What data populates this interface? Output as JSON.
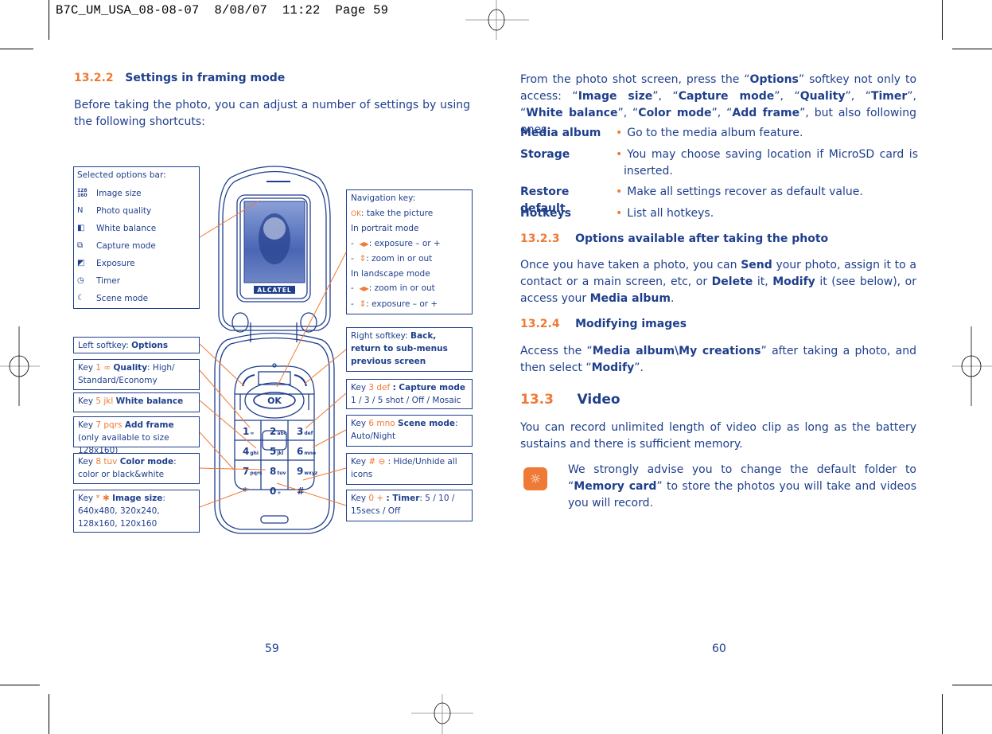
{
  "slug": "B7C_UM_USA_08-08-07  8/08/07  11:22  Page 59",
  "left_page": {
    "section": {
      "number": "13.2.2",
      "title": "Settings in framing mode"
    },
    "intro": "Before taking the photo, you can adjust a number of settings by using the following shortcuts:",
    "options_bar": {
      "title": "Selected options bar:",
      "items": [
        {
          "icon": "image-size-icon",
          "glyph": "128 160",
          "label": "Image size"
        },
        {
          "icon": "photo-quality-icon",
          "glyph": "N",
          "label": "Photo quality"
        },
        {
          "icon": "white-balance-icon",
          "glyph": "◧",
          "label": "White balance"
        },
        {
          "icon": "capture-mode-icon",
          "glyph": "⧉",
          "label": "Capture mode"
        },
        {
          "icon": "exposure-icon",
          "glyph": "◩",
          "label": "Exposure"
        },
        {
          "icon": "timer-icon",
          "glyph": "◷",
          "label": "Timer"
        },
        {
          "icon": "scene-mode-icon",
          "glyph": "☾",
          "label": "Scene mode"
        }
      ]
    },
    "left_callouts": [
      {
        "prefix": "Left softkey: ",
        "key": "",
        "bold": "Options",
        "rest": ""
      },
      {
        "prefix": "Key ",
        "key": "1 ∞",
        "bold": "Quality",
        "rest": ": High/ Standard/Economy"
      },
      {
        "prefix": "Key ",
        "key": "5 jkl",
        "bold": "White balance",
        "rest": ""
      },
      {
        "prefix": "Key ",
        "key": "7 pqrs",
        "bold": "Add frame",
        "rest": " (only available to size 128x160)"
      },
      {
        "prefix": "Key ",
        "key": "8 tuv",
        "bold": "Color mode",
        "rest": ": color or black&white"
      },
      {
        "prefix": "Key ",
        "key": "* ✱",
        "bold": "Image size",
        "rest": ": 640x480, 320x240, 128x160, 120x160"
      }
    ],
    "navigation": {
      "title": "Navigation key:",
      "ok_key": "OK",
      "ok_desc": ": take the picture",
      "portrait_title": "In portrait mode",
      "portrait": [
        {
          "arrows": "◀▶",
          "desc": ": exposure – or +"
        },
        {
          "arrows": "⇕",
          "desc": ": zoom in or out"
        }
      ],
      "landscape_title": "In landscape mode",
      "landscape": [
        {
          "arrows": "◀▶",
          "desc": ": zoom in or out"
        },
        {
          "arrows": "⇕",
          "desc": ": exposure – or +"
        }
      ]
    },
    "right_callouts": [
      {
        "prefix": "Right softkey: ",
        "key": "",
        "bold": "Back, return to sub-menus previous screen",
        "rest": ""
      },
      {
        "prefix": "Key ",
        "key": "3 def",
        "bold": ": Capture mode",
        "rest": " 1 / 3 / 5 shot / Off / Mosaic"
      },
      {
        "prefix": "Key ",
        "key": "6 mno",
        "bold": "Scene mode",
        "rest": ": Auto/Night"
      },
      {
        "prefix": "Key ",
        "key": "# ⊖",
        "bold": "",
        "rest": ": Hide/Unhide all icons"
      },
      {
        "prefix": "Key ",
        "key": "0 +",
        "bold": ": Timer",
        "rest": ": 5 / 10 / 15secs / Off"
      }
    ],
    "phone": {
      "brand": "ALCATEL",
      "ok_label": "OK",
      "keys": [
        {
          "d": "1",
          "l": "∞"
        },
        {
          "d": "2",
          "l": "abc"
        },
        {
          "d": "3",
          "l": "def"
        },
        {
          "d": "4",
          "l": "ghi"
        },
        {
          "d": "5",
          "l": "jkl"
        },
        {
          "d": "6",
          "l": "mno"
        },
        {
          "d": "7",
          "l": "pqrs"
        },
        {
          "d": "8",
          "l": "tuv"
        },
        {
          "d": "9",
          "l": "wxyz"
        },
        {
          "d": "*",
          "l": ""
        },
        {
          "d": "0",
          "l": "+"
        },
        {
          "d": "#",
          "l": ""
        }
      ]
    },
    "page_number": "59"
  },
  "right_page": {
    "intro_parts": [
      {
        "t": "From the photo shot screen, press the “",
        "b": false
      },
      {
        "t": "Options",
        "b": true
      },
      {
        "t": "” softkey not only to access: “",
        "b": false
      },
      {
        "t": "Image size",
        "b": true
      },
      {
        "t": "”, “",
        "b": false
      },
      {
        "t": "Capture mode",
        "b": true
      },
      {
        "t": "”, “",
        "b": false
      },
      {
        "t": "Quality",
        "b": true
      },
      {
        "t": "”, “",
        "b": false
      },
      {
        "t": "Timer",
        "b": true
      },
      {
        "t": "”, “",
        "b": false
      },
      {
        "t": "White balance",
        "b": true
      },
      {
        "t": "”, “",
        "b": false
      },
      {
        "t": "Color mode",
        "b": true
      },
      {
        "t": "”, “",
        "b": false
      },
      {
        "t": "Add frame",
        "b": true
      },
      {
        "t": "”, but also following ones:",
        "b": false
      }
    ],
    "definitions": [
      {
        "term": "Media album",
        "desc": "Go to the media album feature."
      },
      {
        "term": "Storage",
        "desc": "You may choose saving location if MicroSD card is inserted."
      },
      {
        "term": "Restore default",
        "desc": "Make all settings recover as default value."
      },
      {
        "term": "Hotkeys",
        "desc": "List all hotkeys."
      }
    ],
    "section_223": {
      "number": "13.2.3",
      "title": "Options available after taking the photo"
    },
    "para_223_parts": [
      {
        "t": "Once you have taken a photo, you can ",
        "b": false
      },
      {
        "t": "Send",
        "b": true
      },
      {
        "t": " your photo, assign it to a contact or a main screen, etc, or ",
        "b": false
      },
      {
        "t": "Delete",
        "b": true
      },
      {
        "t": " it, ",
        "b": false
      },
      {
        "t": "Modify",
        "b": true
      },
      {
        "t": " it (see below), or access your ",
        "b": false
      },
      {
        "t": "Media album",
        "b": true
      },
      {
        "t": ".",
        "b": false
      }
    ],
    "section_224": {
      "number": "13.2.4",
      "title": "Modifying images"
    },
    "para_224_parts": [
      {
        "t": "Access the “",
        "b": false
      },
      {
        "t": "Media album\\My creations",
        "b": true
      },
      {
        "t": "” after taking a photo, and then select “",
        "b": false
      },
      {
        "t": "Modify",
        "b": true
      },
      {
        "t": "”.",
        "b": false
      }
    ],
    "section_33": {
      "number": "13.3",
      "title": "Video"
    },
    "para_33": "You can record unlimited length of video clip as long as the battery sustains and there is sufficient memory.",
    "tip_parts": [
      {
        "t": "We strongly advise you to change the default folder to “",
        "b": false
      },
      {
        "t": "Memory card",
        "b": true
      },
      {
        "t": "” to store the photos you will take and videos you will record.",
        "b": false
      }
    ],
    "page_number": "60"
  },
  "colors": {
    "text_blue": "#1f3f8c",
    "accent_orange": "#ee7a35"
  }
}
